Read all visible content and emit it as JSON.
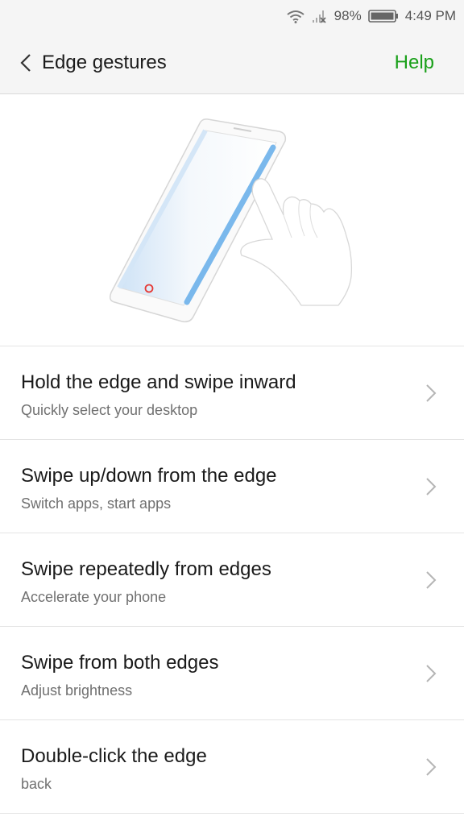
{
  "status_bar": {
    "battery_percent": "98%",
    "time": "4:49 PM",
    "icons": [
      "wifi-icon",
      "signal-icon",
      "battery-icon"
    ]
  },
  "header": {
    "title": "Edge gestures",
    "help_label": "Help",
    "back_icon": "chevron-left-icon",
    "accent_color": "#1aa01a"
  },
  "illustration": {
    "icon": "phone-edge-swipe-illustration",
    "button_color": "#e53935",
    "edge_highlight_color": "#7ab8ec"
  },
  "items": [
    {
      "title": "Hold the edge and swipe inward",
      "subtitle": "Quickly select your desktop"
    },
    {
      "title": "Swipe up/down from the edge",
      "subtitle": "Switch apps, start apps"
    },
    {
      "title": "Swipe repeatedly from edges",
      "subtitle": "Accelerate your phone"
    },
    {
      "title": "Swipe from both edges",
      "subtitle": "Adjust brightness"
    },
    {
      "title": "Double-click the edge",
      "subtitle": "back"
    }
  ]
}
